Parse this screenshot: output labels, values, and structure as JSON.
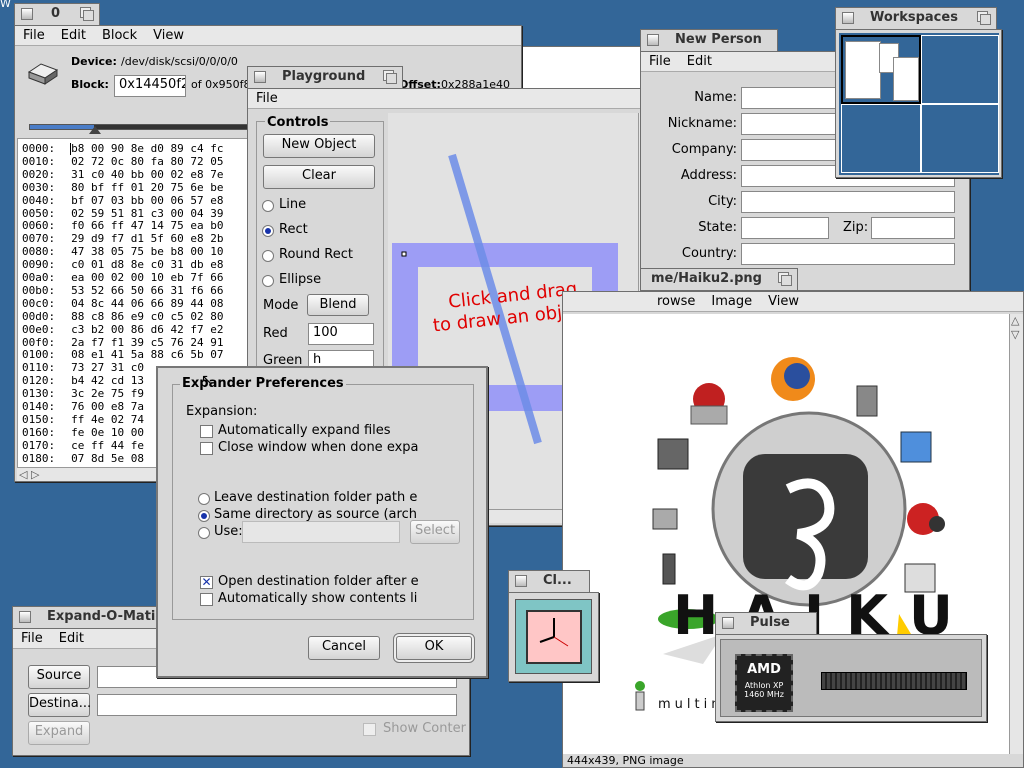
{
  "desktop": {
    "corner_label": "W"
  },
  "diskprobe": {
    "title": "0",
    "menu": [
      "File",
      "Edit",
      "Block",
      "View"
    ],
    "device_label": "Device:",
    "device_value": "/dev/disk/scsi/0/0/0/0",
    "block_label": "Block:",
    "block_value": "0x14450f2",
    "of_label": "of 0x950f8",
    "offset_label": "Offset:",
    "offset_value": "0x288a1e40",
    "rows": [
      {
        "addr": "0000:",
        "bytes": "b8 00 90 8e d0 89 c4 fc"
      },
      {
        "addr": "0010:",
        "bytes": "02 72 0c 80 fa 80 72 05"
      },
      {
        "addr": "0020:",
        "bytes": "31 c0 40 bb 00 02 e8 7e"
      },
      {
        "addr": "0030:",
        "bytes": "80 bf ff 01 20 75 6e be"
      },
      {
        "addr": "0040:",
        "bytes": "bf 07 03 bb 00 06 57 e8"
      },
      {
        "addr": "0050:",
        "bytes": "02 59 51 81 c3 00 04 39"
      },
      {
        "addr": "0060:",
        "bytes": "f0 66 ff 47 14 75 ea b0"
      },
      {
        "addr": "0070:",
        "bytes": "29 d9 f7 d1 5f 60 e8 2b"
      },
      {
        "addr": "0080:",
        "bytes": "47 38 05 75 be b8 00 10"
      },
      {
        "addr": "0090:",
        "bytes": "c0 01 d8 8e c0 31 db e8"
      },
      {
        "addr": "00a0:",
        "bytes": "ea 00 02 00 10 eb 7f 66"
      },
      {
        "addr": "00b0:",
        "bytes": "53 52 66 50 66 31 f6 66"
      },
      {
        "addr": "00c0:",
        "bytes": "04 8c 44 06 66 89 44 08"
      },
      {
        "addr": "00d0:",
        "bytes": "88 c8 86 e9 c0 c5 02 80"
      },
      {
        "addr": "00e0:",
        "bytes": "c3 b2 00 86 d6 42 f7 e2"
      },
      {
        "addr": "00f0:",
        "bytes": "2a f7 f1 39 c5 76 24 91"
      },
      {
        "addr": "0100:",
        "bytes": "08 e1 41 5a 88 c6 5b 07"
      },
      {
        "addr": "0110:",
        "bytes": "73 27 31 c0"
      },
      {
        "addr": "0120:",
        "bytes": "b4 42 cd 13"
      },
      {
        "addr": "0130:",
        "bytes": "3c 2e 75 f9"
      },
      {
        "addr": "0140:",
        "bytes": "76 00 e8 7a"
      },
      {
        "addr": "0150:",
        "bytes": "ff 4e 02 74"
      },
      {
        "addr": "0160:",
        "bytes": "fe 0e 10 00"
      },
      {
        "addr": "0170:",
        "bytes": "ce ff 44 fe"
      },
      {
        "addr": "0180:",
        "bytes": "07 8d 5e 08"
      }
    ]
  },
  "playground": {
    "title": "Playground",
    "menu": [
      "File"
    ],
    "controls_label": "Controls",
    "new_object": "New Object",
    "clear": "Clear",
    "shapes": [
      "Line",
      "Rect",
      "Round Rect",
      "Ellipse"
    ],
    "selected_shape": "Rect",
    "mode_label": "Mode",
    "mode_value": "Blend",
    "red_label": "Red",
    "red_value": "100",
    "green_label": "Green",
    "green_value": "h",
    "canvas_text_1": "Click and drag",
    "canvas_text_2": "to draw an object!"
  },
  "expander_prefs": {
    "title": "Expander Preferences",
    "expansion_label": "Expansion:",
    "auto_expand": "Automatically expand files",
    "close_when_done": "Close window when done expanc",
    "leave_dest": "Leave destination folder path emp",
    "same_dir": "Same directory as source (archiv",
    "use_label": "Use:",
    "select": "Select",
    "open_dest": "Open destination folder after ext",
    "auto_show": "Automatically show contents listir",
    "cancel": "Cancel",
    "ok": "OK"
  },
  "expandomatic": {
    "title": "Expand-O-Matic",
    "menu": [
      "File",
      "Edit"
    ],
    "source": "Source",
    "destination": "Destina...",
    "expand": "Expand",
    "show_contents": "Show Conter"
  },
  "new_person": {
    "title": "New Person",
    "menu": [
      "File",
      "Edit"
    ],
    "fields": [
      "Name:",
      "Nickname:",
      "Company:",
      "Address:",
      "City:",
      "State:",
      "Country:"
    ],
    "zip_label": "Zip:"
  },
  "workspaces": {
    "title": "Workspaces"
  },
  "showimage": {
    "title": "me/Haiku2.png",
    "menu": [
      "rowse",
      "Image",
      "View"
    ],
    "status": "444x439, PNG image",
    "logo_text": "HAIKU",
    "tagline": "multim"
  },
  "clock": {
    "title": "Cl..."
  },
  "pulse": {
    "title": "Pulse",
    "cpu_brand": "AMD",
    "cpu_model": "Athlon XP",
    "cpu_speed": "1460 MHz"
  },
  "colors": {
    "desktop": "#336698",
    "title_active": "#ffcb00",
    "panel": "#d8d8d8",
    "accent": "#1733aa",
    "canvas_text": "#e00000"
  }
}
